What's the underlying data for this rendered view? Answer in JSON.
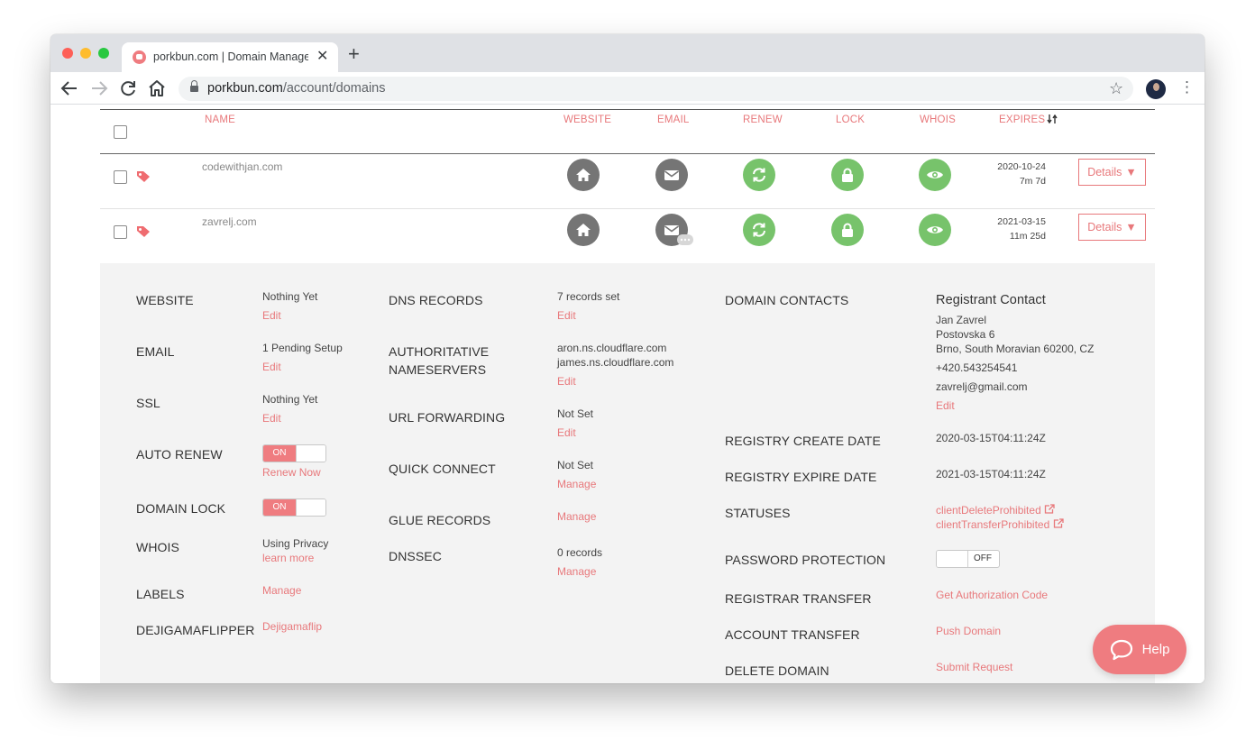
{
  "browser": {
    "tab_title": "porkbun.com | Domain Management",
    "url_host": "porkbun.com",
    "url_path": "/account/domains"
  },
  "table": {
    "headers": {
      "name": "NAME",
      "website": "WEBSITE",
      "email": "EMAIL",
      "renew": "RENEW",
      "lock": "LOCK",
      "whois": "WHOIS",
      "expires": "EXPIRES"
    },
    "rows": [
      {
        "domain": "codewithjan.com",
        "expires_date": "2020-10-24",
        "expires_left": "7m 7d",
        "details_label": "Details"
      },
      {
        "domain": "zavrelj.com",
        "expires_date": "2021-03-15",
        "expires_left": "11m 25d",
        "details_label": "Details"
      }
    ]
  },
  "details": {
    "col1": {
      "website": {
        "label": "WEBSITE",
        "value": "Nothing Yet",
        "link": "Edit"
      },
      "email": {
        "label": "EMAIL",
        "value": "1 Pending Setup",
        "link": "Edit"
      },
      "ssl": {
        "label": "SSL",
        "value": "Nothing Yet",
        "link": "Edit"
      },
      "auto_renew": {
        "label": "AUTO RENEW",
        "toggle": "ON",
        "link": "Renew Now"
      },
      "domain_lock": {
        "label": "DOMAIN LOCK",
        "toggle": "ON"
      },
      "whois": {
        "label": "WHOIS",
        "value": "Using Privacy",
        "link": "learn more"
      },
      "labels": {
        "label": "LABELS",
        "link": "Manage"
      },
      "dejigamaflipper": {
        "label": "DEJIGAMAFLIPPER",
        "link": "Dejigamaflip"
      }
    },
    "col2": {
      "dns_records": {
        "label": "DNS RECORDS",
        "value": "7 records set",
        "link": "Edit"
      },
      "nameservers": {
        "label_1": "AUTHORITATIVE",
        "label_2": "NAMESERVERS",
        "value_1": "aron.ns.cloudflare.com",
        "value_2": "james.ns.cloudflare.com",
        "link": "Edit"
      },
      "url_forwarding": {
        "label": "URL FORWARDING",
        "value": "Not Set",
        "link": "Edit"
      },
      "quick_connect": {
        "label": "QUICK CONNECT",
        "value": "Not Set",
        "link": "Manage"
      },
      "glue_records": {
        "label": "GLUE RECORDS",
        "link": "Manage"
      },
      "dnssec": {
        "label": "DNSSEC",
        "value": "0 records",
        "link": "Manage"
      }
    },
    "col3": {
      "domain_contacts": {
        "label": "DOMAIN CONTACTS",
        "title": "Registrant Contact",
        "name": "Jan Zavrel",
        "street": "Postovska 6",
        "city": "Brno, South Moravian 60200, CZ",
        "phone": "+420.543254541",
        "email": "zavrelj@gmail.com",
        "link": "Edit"
      },
      "create_date": {
        "label": "REGISTRY CREATE DATE",
        "value": "2020-03-15T04:11:24Z"
      },
      "expire_date": {
        "label": "REGISTRY EXPIRE DATE",
        "value": "2021-03-15T04:11:24Z"
      },
      "statuses": {
        "label": "STATUSES",
        "value_1": "clientDeleteProhibited",
        "value_2": "clientTransferProhibited"
      },
      "password_protection": {
        "label": "PASSWORD PROTECTION",
        "toggle": "OFF"
      },
      "registrar_transfer": {
        "label": "REGISTRAR TRANSFER",
        "link": "Get Authorization Code"
      },
      "account_transfer": {
        "label": "ACCOUNT TRANSFER",
        "link": "Push Domain"
      },
      "delete_domain": {
        "label": "DELETE DOMAIN",
        "link": "Submit Request"
      }
    }
  },
  "help": {
    "label": "Help"
  },
  "colors": {
    "accent": "#e8787b",
    "toggle_on": "#ef7c80",
    "icon_grey": "#757575",
    "icon_green": "#77c36b",
    "panel_bg": "#f3f3f3"
  },
  "icons": [
    "home-icon",
    "envelope-icon",
    "refresh-icon",
    "padlock-icon",
    "eye-icon",
    "tag-icon",
    "external-link-icon",
    "chat-bubble-icon"
  ]
}
